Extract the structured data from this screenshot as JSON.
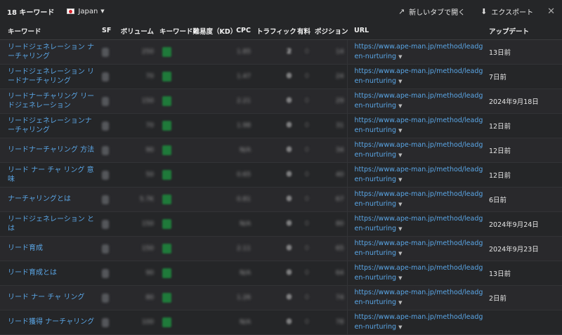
{
  "header": {
    "keyword_count": "18 キーワード",
    "country": "Japan",
    "open_new_tab": "新しいタブで開く",
    "export": "エクスポート",
    "close": "✕"
  },
  "columns": {
    "keyword": "キーワード",
    "sf": "SF",
    "volume": "ボリューム",
    "kd": "キーワード難易度（KD）",
    "cpc": "CPC",
    "traffic": "トラフィック",
    "paid": "有料",
    "position": "ポジション",
    "url": "URL",
    "updated": "アップデート"
  },
  "rows": [
    {
      "keyword": "リードジェネレーション ナーチャリング",
      "sf": "3",
      "volume": "250",
      "kd": "0",
      "cpc": "1.85",
      "traffic": "2",
      "paid": "0",
      "position": "14",
      "url": "https://www.ape-man.jp/method/leadgen-nurturing",
      "updated": "13日前"
    },
    {
      "keyword": "リードジェネレーション リードナーチャリング",
      "sf": "2",
      "volume": "70",
      "kd": "0",
      "cpc": "1.47",
      "traffic": "0",
      "paid": "0",
      "position": "24",
      "url": "https://www.ape-man.jp/method/leadgen-nurturing",
      "updated": "7日前"
    },
    {
      "keyword": "リードナーチャリング リードジェネレーション",
      "sf": "2",
      "volume": "150",
      "kd": "0",
      "cpc": "2.21",
      "traffic": "0",
      "paid": "0",
      "position": "29",
      "url": "https://www.ape-man.jp/method/leadgen-nurturing",
      "updated": "2024年9月18日"
    },
    {
      "keyword": "リードジェネレーションナーチャリング",
      "sf": "2",
      "volume": "70",
      "kd": "0",
      "cpc": "1.98",
      "traffic": "0",
      "paid": "0",
      "position": "31",
      "url": "https://www.ape-man.jp/method/leadgen-nurturing",
      "updated": "12日前"
    },
    {
      "keyword": "リードナーチャリング 方法",
      "sf": "2",
      "volume": "90",
      "kd": "2",
      "cpc": "N/A",
      "traffic": "0",
      "paid": "0",
      "position": "34",
      "url": "https://www.ape-man.jp/method/leadgen-nurturing",
      "updated": "12日前"
    },
    {
      "keyword": "リード ナー チャ リング 意味",
      "sf": "4",
      "volume": "50",
      "kd": "3",
      "cpc": "0.65",
      "traffic": "0",
      "paid": "0",
      "position": "40",
      "url": "https://www.ape-man.jp/method/leadgen-nurturing",
      "updated": "12日前"
    },
    {
      "keyword": "ナーチャリングとは",
      "sf": "3",
      "volume": "5.7K",
      "kd": "1",
      "cpc": "0.81",
      "traffic": "0",
      "paid": "0",
      "position": "67",
      "url": "https://www.ape-man.jp/method/leadgen-nurturing",
      "updated": "6日前"
    },
    {
      "keyword": "リードジェネレーション とは",
      "sf": "2",
      "volume": "150",
      "kd": "2",
      "cpc": "N/A",
      "traffic": "0",
      "paid": "0",
      "position": "80",
      "url": "https://www.ape-man.jp/method/leadgen-nurturing",
      "updated": "2024年9月24日"
    },
    {
      "keyword": "リード育成",
      "sf": "3",
      "volume": "150",
      "kd": "2",
      "cpc": "2.11",
      "traffic": "0",
      "paid": "0",
      "position": "65",
      "url": "https://www.ape-man.jp/method/leadgen-nurturing",
      "updated": "2024年9月23日"
    },
    {
      "keyword": "リード育成とは",
      "sf": "4",
      "volume": "90",
      "kd": "0",
      "cpc": "N/A",
      "traffic": "0",
      "paid": "0",
      "position": "64",
      "url": "https://www.ape-man.jp/method/leadgen-nurturing",
      "updated": "13日前"
    },
    {
      "keyword": "リード ナー チャ リング",
      "sf": "3",
      "volume": "80",
      "kd": "1",
      "cpc": "1.26",
      "traffic": "0",
      "paid": "0",
      "position": "74",
      "url": "https://www.ape-man.jp/method/leadgen-nurturing",
      "updated": "2日前"
    },
    {
      "keyword": "リード獲得 ナーチャリング",
      "sf": "2",
      "volume": "100",
      "kd": "0",
      "cpc": "N/A",
      "traffic": "0",
      "paid": "0",
      "position": "78",
      "url": "https://www.ape-man.jp/method/leadgen-nurturing",
      "updated": ""
    }
  ],
  "colors": {
    "background": "#252628",
    "link": "#5aa6e6",
    "kd_badge": "#1f7a3a"
  },
  "icons": {
    "flag": "japan-flag-icon",
    "open_new_tab": "external-link-icon",
    "export": "export-icon",
    "close": "close-icon"
  }
}
